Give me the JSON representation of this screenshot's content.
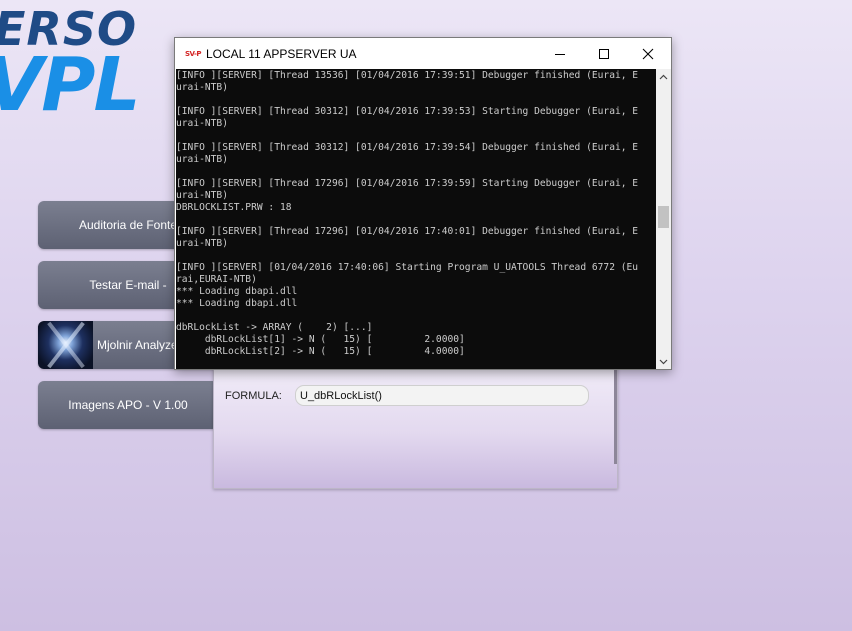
{
  "logo": {
    "line1": "ERSO",
    "line2": "VPL"
  },
  "menu": {
    "items": [
      {
        "label": "Auditoria de Fonte"
      },
      {
        "label": "Testar E-mail -"
      },
      {
        "label": "Mjolnir Analyzer",
        "icon": "mjolnir-thumbnail"
      },
      {
        "label": "Imagens APO - V 1.00"
      }
    ]
  },
  "formula": {
    "label": "FORMULA:",
    "value": "U_dbRLockList()"
  },
  "console": {
    "app_icon_text": "SV-P",
    "title": "LOCAL 11 APPSERVER UA",
    "lines": [
      "[INFO ][SERVER] [Thread 13536] [01/04/2016 17:39:51] Debugger finished (Eurai, E",
      "urai-NTB)",
      "",
      "[INFO ][SERVER] [Thread 30312] [01/04/2016 17:39:53] Starting Debugger (Eurai, E",
      "urai-NTB)",
      "",
      "[INFO ][SERVER] [Thread 30312] [01/04/2016 17:39:54] Debugger finished (Eurai, E",
      "urai-NTB)",
      "",
      "[INFO ][SERVER] [Thread 17296] [01/04/2016 17:39:59] Starting Debugger (Eurai, E",
      "urai-NTB)",
      "DBRLOCKLIST.PRW : 18",
      "",
      "[INFO ][SERVER] [Thread 17296] [01/04/2016 17:40:01] Debugger finished (Eurai, E",
      "urai-NTB)",
      "",
      "[INFO ][SERVER] [01/04/2016 17:40:06] Starting Program U_UATOOLS Thread 6772 (Eu",
      "rai,EURAI-NTB)",
      "*** Loading dbapi.dll",
      "*** Loading dbapi.dll",
      "",
      "dbRLockList -> ARRAY (    2) [...]",
      "     dbRLockList[1] -> N (   15) [         2.0000]",
      "     dbRLockList[2] -> N (   15) [         4.0000]"
    ]
  },
  "colors": {
    "accent_blue": "#1a8fe6",
    "logo_dark_blue": "#1f4b86",
    "console_bg": "#0c0c0c",
    "console_text": "#cccccc"
  }
}
